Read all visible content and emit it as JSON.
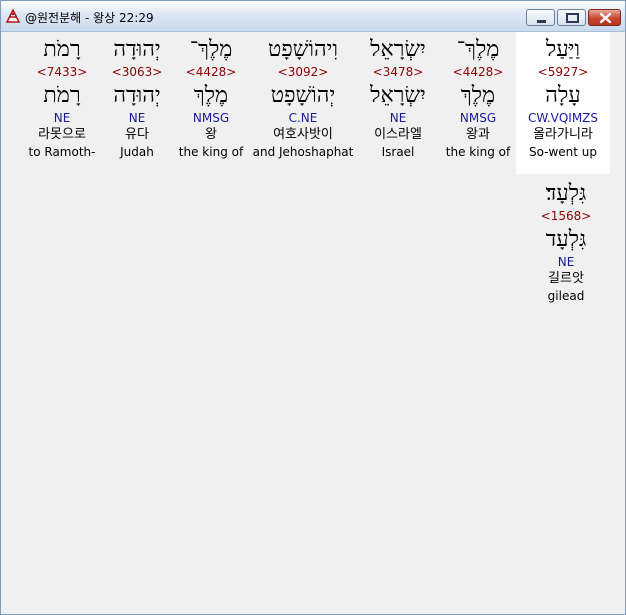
{
  "window": {
    "title": "@원전분해 - 왕상 22:29"
  },
  "words": [
    {
      "hebrew": "וַיַּעַל",
      "strong": "<5927>",
      "lemma": "עָלָה",
      "morph": "CW.VQIMZS",
      "korean": "올라가니라",
      "english": "So-went up"
    },
    {
      "hebrew": "מֶלֶךְ־",
      "strong": "<4428>",
      "lemma": "מֶלֶךְ",
      "morph": "NMSG",
      "korean": "왕과",
      "english": "the king of"
    },
    {
      "hebrew": "יִשְׂרָאֵל",
      "strong": "<3478>",
      "lemma": "יִשְׂרָאֵל",
      "morph": "NE",
      "korean": "이스라엘",
      "english": "Israel"
    },
    {
      "hebrew": "וִיהוֹשָׁפָט",
      "strong": "<3092>",
      "lemma": "יְהוֹשָׁפָט",
      "morph": "C.NE",
      "korean": "여호사밧이",
      "english": "and Jehoshaphat"
    },
    {
      "hebrew": "מֶלֶךְ־",
      "strong": "<4428>",
      "lemma": "מֶלֶךְ",
      "morph": "NMSG",
      "korean": "왕",
      "english": "the king of"
    },
    {
      "hebrew": "יְהוּדָה",
      "strong": "<3063>",
      "lemma": "יְהוּדָה",
      "morph": "NE",
      "korean": "유다",
      "english": "Judah"
    },
    {
      "hebrew": "רָמֹת",
      "strong": "<7433>",
      "lemma": "רָמֹת",
      "morph": "NE",
      "korean": "라못으로",
      "english": "to Ramoth-"
    },
    {
      "hebrew": "גִּלְעָד׃",
      "strong": "<1568>",
      "lemma": "גִּלְעָד",
      "morph": "NE",
      "korean": "길르앗",
      "english": "gilead"
    }
  ]
}
